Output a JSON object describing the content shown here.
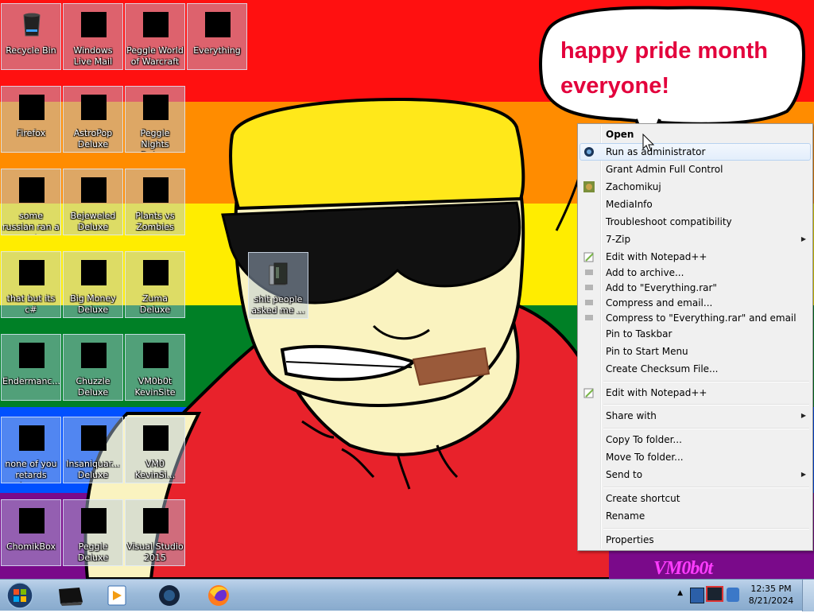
{
  "wallpaper": {
    "bubble_line1": "happy pride month",
    "bubble_line2": "everyone!",
    "watermark": "VM0b0t",
    "stripe_colors": [
      "#ff0000",
      "#ff8c00",
      "#ffed00",
      "#008026",
      "#004dff",
      "#750787"
    ]
  },
  "desktop_icons": [
    {
      "label": "Recycle Bin",
      "icon": "recycle-bin-icon"
    },
    {
      "label": "Windows Live Mail",
      "icon": "mail-icon"
    },
    {
      "label": "Peggle World of Warcraft ...",
      "icon": "game-icon"
    },
    {
      "label": "Everything",
      "icon": "search-icon"
    },
    {
      "label": "Firefox",
      "icon": "firefox-icon"
    },
    {
      "label": "AstroPop Deluxe",
      "icon": "game-icon"
    },
    {
      "label": "Peggle Nights Deluxe",
      "icon": "game-icon"
    },
    {
      "label": "some russian ran a rat",
      "icon": "app-icon"
    },
    {
      "label": "Bejeweled Deluxe",
      "icon": "gem-icon"
    },
    {
      "label": "Plants vs Zombies",
      "icon": "game-icon"
    },
    {
      "label": "that but its c#",
      "icon": "app-icon"
    },
    {
      "label": "Big Money Deluxe",
      "icon": "game-icon"
    },
    {
      "label": "Zuma Deluxe",
      "icon": "game-icon"
    },
    {
      "label": "Endermanc...",
      "icon": "app-icon"
    },
    {
      "label": "Chuzzle Deluxe",
      "icon": "game-icon"
    },
    {
      "label": "VM0b0t KevinSite",
      "icon": "shortcut-icon"
    },
    {
      "label": "none of you retards kno...",
      "icon": "app-icon"
    },
    {
      "label": "Insaniquar... Deluxe",
      "icon": "game-icon"
    },
    {
      "label": "VM0 KevinSi...",
      "icon": "shortcut-icon"
    },
    {
      "label": "ChomikBox",
      "icon": "app-icon"
    },
    {
      "label": "Peggle Deluxe",
      "icon": "game-icon"
    },
    {
      "label": "Visual Studio 2015",
      "icon": "visual-studio-icon"
    },
    {
      "label": "shit people asked me ...",
      "icon": "folder-icon"
    }
  ],
  "context_menu": {
    "items": [
      {
        "label": "Open",
        "bold": true
      },
      {
        "label": "Run as administrator",
        "icon": "shield-icon"
      },
      {
        "label": "Grant Admin Full Control"
      },
      {
        "label": "Zachomikuj",
        "icon": "chomik-icon"
      },
      {
        "label": "MediaInfo"
      },
      {
        "label": "Troubleshoot compatibility"
      },
      {
        "label": "7-Zip",
        "submenu": true
      },
      {
        "label": "Edit with Notepad++",
        "icon": "notepad-icon"
      },
      {
        "label": "Add to archive...",
        "icon": "archive-icon"
      },
      {
        "label": "Add to \"Everything.rar\"",
        "icon": "archive-icon"
      },
      {
        "label": "Compress and email...",
        "icon": "archive-icon"
      },
      {
        "label": "Compress to \"Everything.rar\" and email",
        "icon": "archive-icon"
      },
      {
        "label": "Pin to Taskbar"
      },
      {
        "label": "Pin to Start Menu"
      },
      {
        "label": "Create Checksum File..."
      },
      {
        "label": "Edit with Notepad++",
        "icon": "notepad-icon"
      },
      {
        "label": "Share with",
        "submenu": true
      },
      {
        "label": "Copy To folder..."
      },
      {
        "label": "Move To folder..."
      },
      {
        "label": "Send to",
        "submenu": true
      },
      {
        "label": "Create shortcut"
      },
      {
        "label": "Rename"
      },
      {
        "label": "Properties"
      }
    ]
  },
  "taskbar": {
    "pinned": [
      "explorer-icon",
      "media-player-icon",
      "app-icon",
      "firefox-icon"
    ],
    "clock_time": "12:35 PM",
    "clock_date": "8/21/2024",
    "tray_arrow": "▲"
  }
}
